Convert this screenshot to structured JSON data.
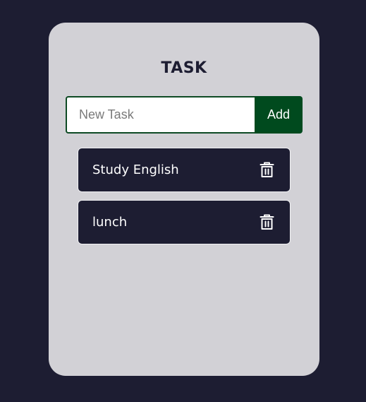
{
  "header": {
    "title": "TASK"
  },
  "form": {
    "input_value": "",
    "input_placeholder": "New Task",
    "add_label": "Add"
  },
  "tasks": [
    {
      "text": "Study English",
      "icon": "trash-icon"
    },
    {
      "text": "lunch",
      "icon": "trash-icon"
    }
  ],
  "colors": {
    "background": "#1d1d32",
    "card": "#d2d1d6",
    "accent": "#004a1e",
    "task_bg": "#1d1d32",
    "task_text": "#ffffff"
  }
}
